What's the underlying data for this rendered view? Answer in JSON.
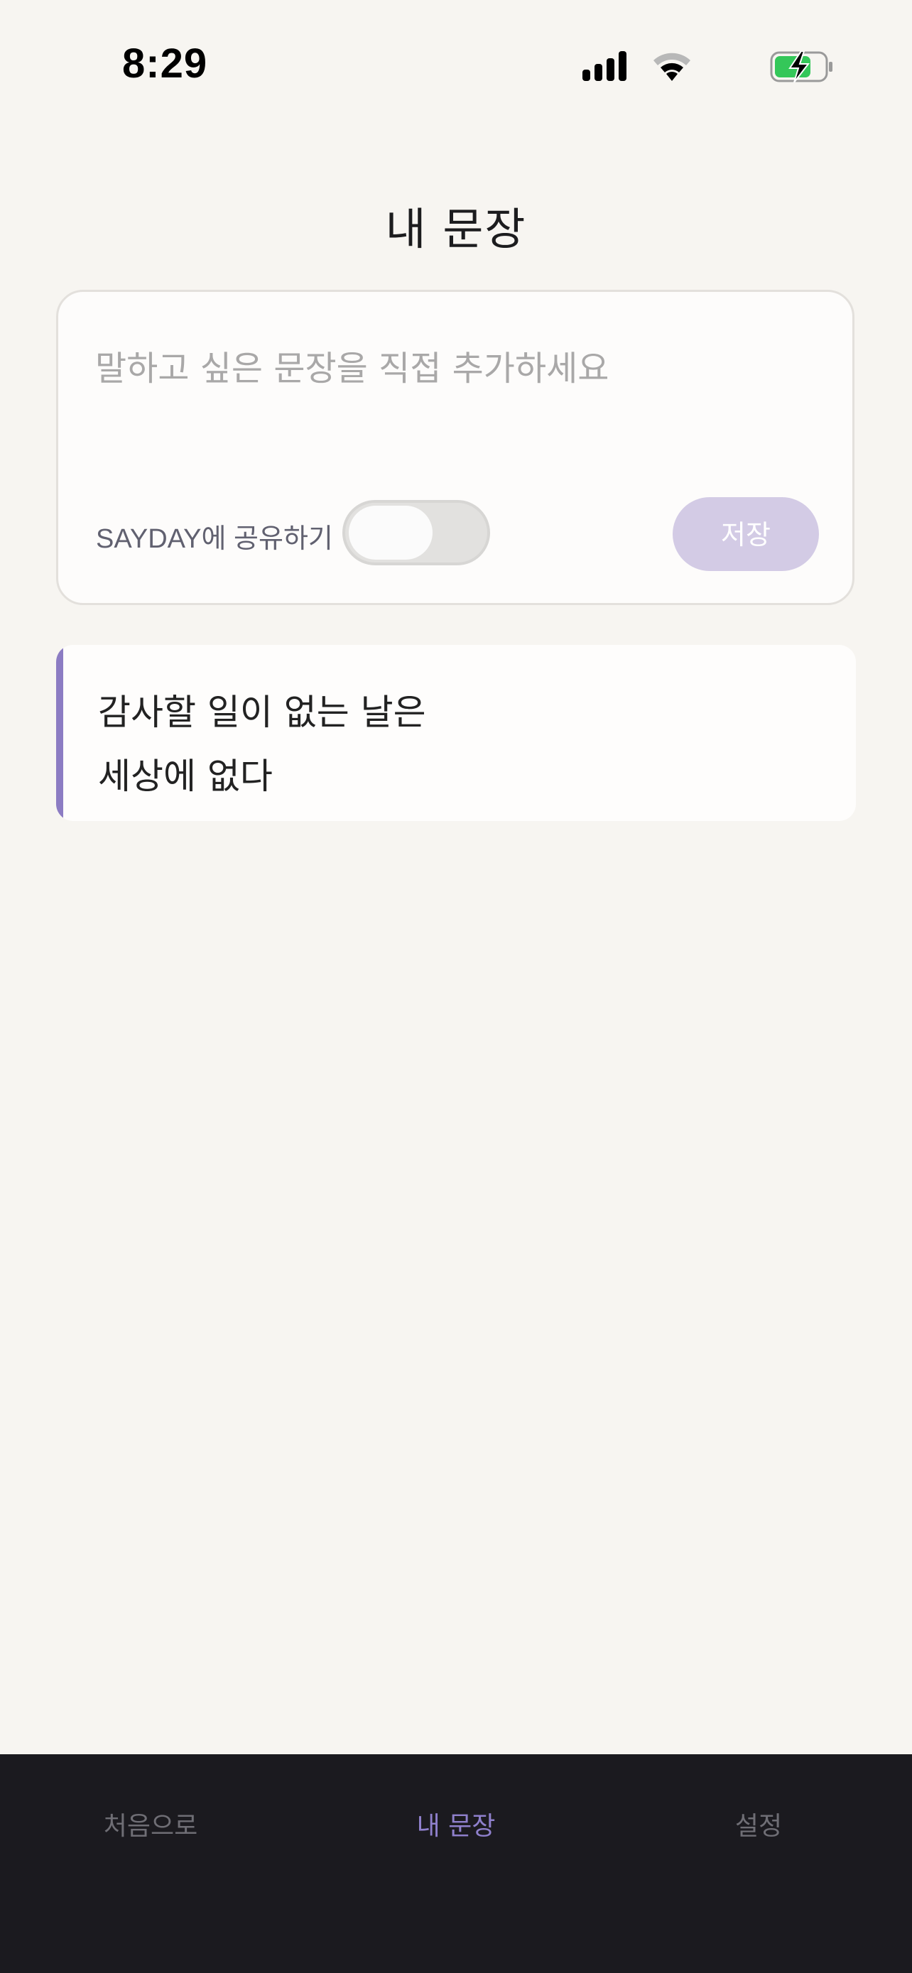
{
  "status_bar": {
    "time": "8:29",
    "icons": [
      "cellular-signal-icon",
      "wifi-icon",
      "battery-charging-icon"
    ]
  },
  "header": {
    "title": "내 문장"
  },
  "composer": {
    "placeholder": "말하고 싶은 문장을 직접 추가하세요",
    "value": "",
    "share_label": "SAYDAY에 공유하기",
    "share_enabled": false,
    "save_label": "저장"
  },
  "sentences": [
    {
      "lines": [
        "감사할 일이 없는 날은",
        "세상에 없다"
      ]
    }
  ],
  "tab_bar": {
    "tabs": [
      {
        "label": "처음으로",
        "active": false
      },
      {
        "label": "내 문장",
        "active": true
      },
      {
        "label": "설정",
        "active": false
      }
    ]
  },
  "colors": {
    "background": "#f7f5f1",
    "accent": "#8c7cc3",
    "save_button": "#d3cbe5",
    "tab_bar": "#1b1a1f",
    "battery": "#34c759"
  }
}
